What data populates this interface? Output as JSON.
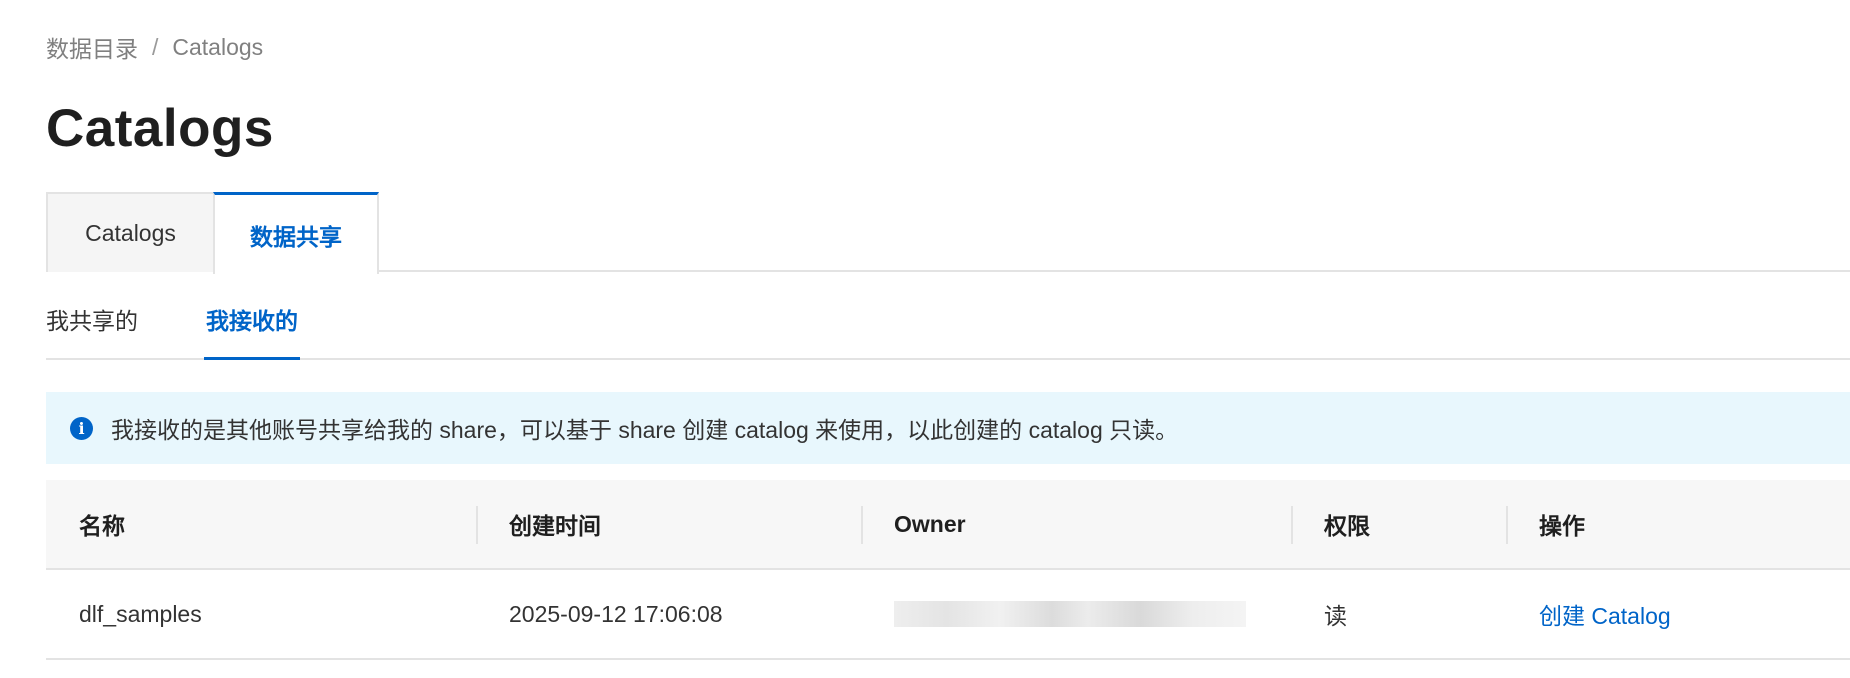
{
  "breadcrumb": {
    "parent": "数据目录",
    "separator": "/",
    "current": "Catalogs"
  },
  "page_title": "Catalogs",
  "main_tabs": [
    {
      "label": "Catalogs",
      "active": false
    },
    {
      "label": "数据共享",
      "active": true
    }
  ],
  "sub_tabs": [
    {
      "label": "我共享的",
      "active": false
    },
    {
      "label": "我接收的",
      "active": true
    }
  ],
  "banner": {
    "icon": "info-icon",
    "icon_glyph": "i",
    "text": "我接收的是其他账号共享给我的 share，可以基于 share 创建 catalog 来使用，以此创建的 catalog 只读。"
  },
  "table": {
    "columns": [
      "名称",
      "创建时间",
      "Owner",
      "权限",
      "操作"
    ],
    "rows": [
      {
        "name": "dlf_samples",
        "created": "2025-09-12 17:06:08",
        "permission": "读",
        "action": "创建 Catalog"
      }
    ]
  },
  "colors": {
    "accent": "#0064c8",
    "banner_bg": "#e8f7fd",
    "header_bg": "#f7f7f7"
  }
}
